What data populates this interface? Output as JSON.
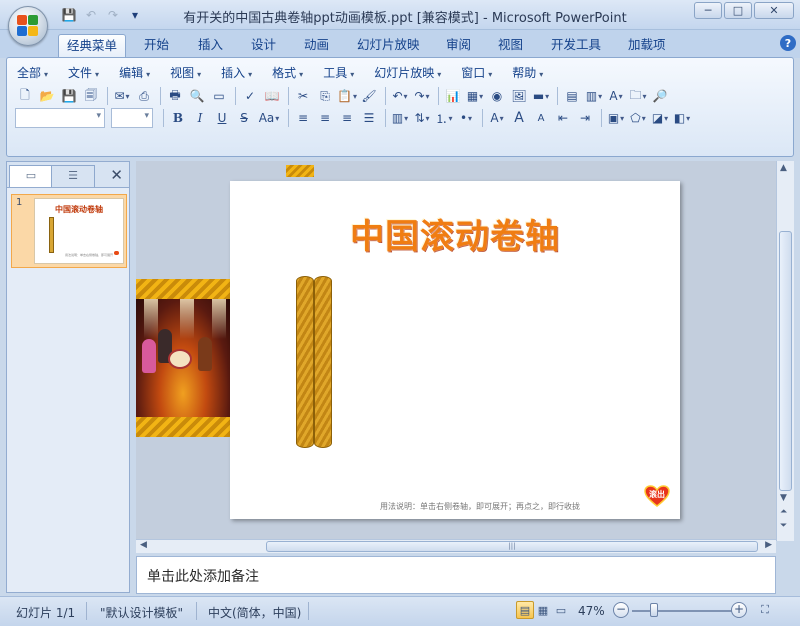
{
  "window": {
    "title": "有开关的中国古典卷轴ppt动画模板.ppt [兼容模式] - Microsoft PowerPoint",
    "controls": {
      "minimize": "─",
      "maximize": "□",
      "close": "✕"
    }
  },
  "qat": {
    "save": "💾",
    "undo": "↶",
    "redo": "↷",
    "more": "▾"
  },
  "tabs": [
    "经典菜单",
    "开始",
    "插入",
    "设计",
    "动画",
    "幻灯片放映",
    "审阅",
    "视图",
    "开发工具",
    "加载项"
  ],
  "help": "?",
  "classic_menu": [
    "全部",
    "文件",
    "编辑",
    "视图",
    "插入",
    "格式",
    "工具",
    "幻灯片放映",
    "窗口",
    "帮助"
  ],
  "format_buttons": {
    "bold": "B",
    "italic": "I",
    "underline": "U",
    "shadow": "S",
    "shadow_dd": "Aa",
    "grow": "A",
    "shrink": "A",
    "text_box": "A"
  },
  "slides_panel": {
    "slide_number": "1",
    "close": "✕",
    "thumb_title": "中国滚动卷轴",
    "thumb_note": "用法说明：单击右侧卷轴，即可展开"
  },
  "slide": {
    "title": "中国滚动卷轴",
    "note": "用法说明：单击右侧卷轴，即可展开；再点之，即行收拢",
    "heart_label": "滚出"
  },
  "notes": {
    "placeholder": "单击此处添加备注"
  },
  "status": {
    "slide": "幻灯片 1/1",
    "theme": "\"默认设计模板\"",
    "language": "中文(简体，中国)",
    "zoom": "47%",
    "zoom_minus": "−",
    "zoom_plus": "+"
  },
  "colors": {
    "accent": "#15428b",
    "title_orange": "#f07d12",
    "rod_gold": "#d39b22"
  }
}
